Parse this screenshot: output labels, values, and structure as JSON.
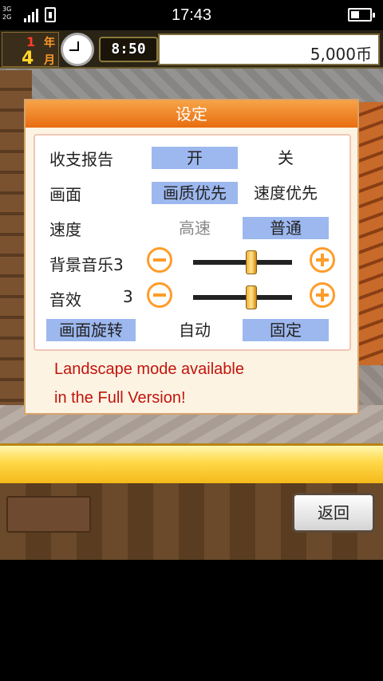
{
  "status_bar": {
    "network_top": "3G",
    "network_bottom": "2G",
    "time": "17:43"
  },
  "hud": {
    "year_num": "1",
    "year_unit": "年",
    "month_num": "4",
    "month_unit": "月",
    "game_time": "8:50",
    "money": "5,000币"
  },
  "dialog": {
    "title": "设定",
    "rows": {
      "report": {
        "label": "收支报告",
        "on": "开",
        "off": "关",
        "selected": "on"
      },
      "screen": {
        "label": "画面",
        "quality": "画质优先",
        "speed": "速度优先",
        "selected": "quality"
      },
      "speed": {
        "label": "速度",
        "fast": "高速",
        "normal": "普通",
        "selected": "normal"
      },
      "bgm": {
        "label": "背景音乐",
        "value": "3"
      },
      "sfx": {
        "label": "音效",
        "value": "3"
      },
      "rotation": {
        "label": "画面旋转",
        "auto": "自动",
        "fixed": "固定",
        "selected": "fixed"
      }
    },
    "notice_line1": "Landscape mode available",
    "notice_line2": "in the Full Version!"
  },
  "bottom": {
    "back_label": "返回"
  },
  "colors": {
    "title_orange": "#e86d10",
    "selected_blue": "#9db8ef",
    "notice_red": "#c0140e",
    "button_orange": "#ff9c2a"
  }
}
